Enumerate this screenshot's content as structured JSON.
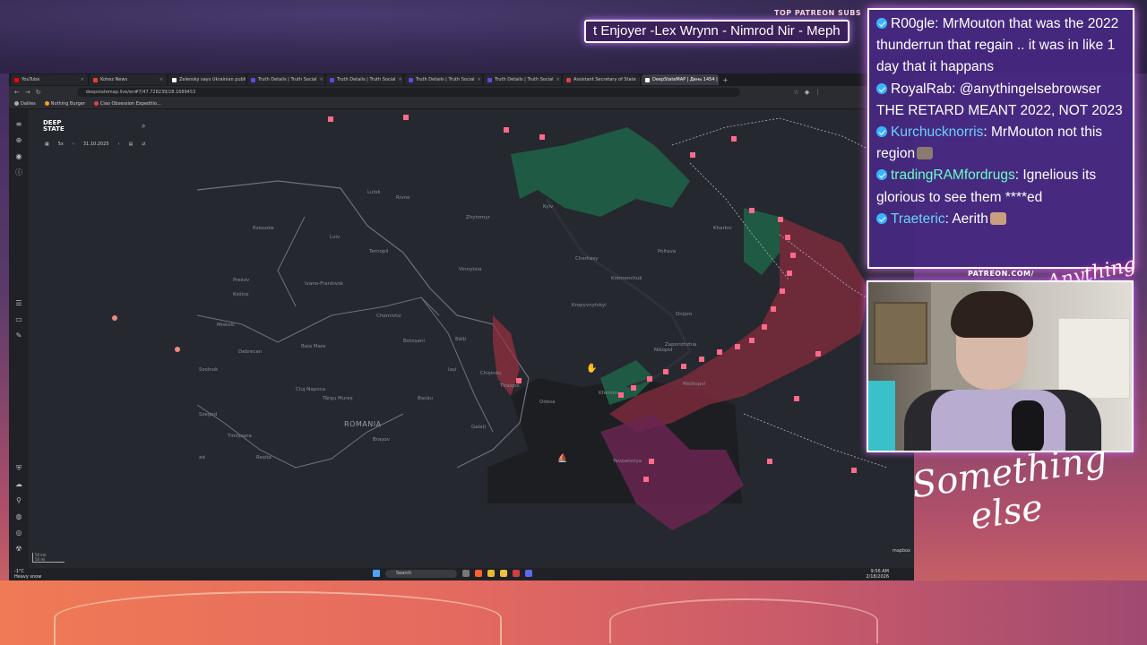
{
  "patreon": {
    "label": "TOP PATREON SUBS",
    "ticker": "t Enjoyer -Lex Wrynn - Nimrod Nir - Meph"
  },
  "browser": {
    "tabs": [
      {
        "label": "YouTube",
        "color": "#ff0000"
      },
      {
        "label": "Kohez News",
        "color": "#e8402a"
      },
      {
        "label": "Zelensky says Ukrainian public",
        "color": "#ffffff"
      },
      {
        "label": "Truth Details | Truth Social",
        "color": "#5a4ae0"
      },
      {
        "label": "Truth Details | Truth Social",
        "color": "#5a4ae0"
      },
      {
        "label": "Truth Details | Truth Social",
        "color": "#5a4ae0"
      },
      {
        "label": "Truth Details | Truth Social",
        "color": "#5a4ae0"
      },
      {
        "label": "Assistant Secretary of State",
        "color": "#e04040"
      },
      {
        "label": "DeepStateMAP | День 1454 | Карт",
        "color": "#ffffff"
      }
    ],
    "url": "deepstatemap.live/en#7/47.728239/28.1689453",
    "bookmarks": [
      {
        "label": "Dailies",
        "color": "#aaaaaa"
      },
      {
        "label": "Nothing Burger",
        "color": "#f0a020"
      },
      {
        "label": "Ciao Obsession Expeditio...",
        "color": "#e04040"
      }
    ]
  },
  "map": {
    "brand": "DEEP STATE",
    "date": "31.10.2025",
    "zoom_label": "5x",
    "labels": [
      {
        "text": "Lutsk"
      },
      {
        "text": "Rivne"
      },
      {
        "text": "Zhytomyr"
      },
      {
        "text": "Kyiv"
      },
      {
        "text": "Rzeszów"
      },
      {
        "text": "Lviv"
      },
      {
        "text": "Ternopil"
      },
      {
        "text": "Vinnytsia"
      },
      {
        "text": "Cherkasy"
      },
      {
        "text": "Poltava"
      },
      {
        "text": "Kharkiv"
      },
      {
        "text": "Kremenchuk"
      },
      {
        "text": "Prešov"
      },
      {
        "text": "Košice"
      },
      {
        "text": "Ivano-Frankivsk"
      },
      {
        "text": "Kropyvnytskyi"
      },
      {
        "text": "Dnipro"
      },
      {
        "text": "Chernivtsi"
      },
      {
        "text": "Miskolc"
      },
      {
        "text": "Zaporizhzhia"
      },
      {
        "text": "Baia Mare"
      },
      {
        "text": "Botoșani"
      },
      {
        "text": "Bălți"
      },
      {
        "text": "Debrecen"
      },
      {
        "text": "Nikopol"
      },
      {
        "text": "Iași"
      },
      {
        "text": "Chișinău"
      },
      {
        "text": "Szolnok"
      },
      {
        "text": "Cluj-Napoca"
      },
      {
        "text": "Tiraspol"
      },
      {
        "text": "Kherson"
      },
      {
        "text": "Melitopol"
      },
      {
        "text": "Odesa"
      },
      {
        "text": "Târgu Mureș"
      },
      {
        "text": "Bacău"
      },
      {
        "text": "ROMANIA"
      },
      {
        "text": "Szeged"
      },
      {
        "text": "Galați"
      },
      {
        "text": "Timișoara"
      },
      {
        "text": "Brașov"
      },
      {
        "text": "Yevpatoriya"
      },
      {
        "text": "Reșița"
      },
      {
        "text": "ad"
      }
    ],
    "scale_km": "50 km",
    "scale_mi": "50 mi",
    "attribution": "mapbox"
  },
  "taskbar": {
    "weather_temp": "-1°C",
    "weather_desc": "Heavy snow",
    "search": "Search",
    "time": "9:56 AM",
    "date": "2/18/2026"
  },
  "chat": [
    {
      "user": "R00gle",
      "user_color": "#ffffff",
      "text": "MrMouton that was the 2022 thunderrun that regain .. it was in like 1 day that it happans"
    },
    {
      "user": "RoyalRab",
      "user_color": "#ffffff",
      "text": "@anythingelsebrowser THE RETARD MEANT 2022, NOT 2023"
    },
    {
      "user": "Kurchucknorris",
      "user_color": "#6ad0ff",
      "text": "MrMouton not this region"
    },
    {
      "user": "tradingRAMfordrugs",
      "user_color": "#6affc8",
      "text": "Ignelious its glorious to see them ****ed"
    },
    {
      "user": "Traeteric",
      "user_color": "#6ad0ff",
      "text": "Aerith"
    }
  ],
  "branding": {
    "patreon_url": "PATREON.COM/",
    "logo": "Anything else",
    "script_line1": "Something",
    "script_line2": "else"
  }
}
